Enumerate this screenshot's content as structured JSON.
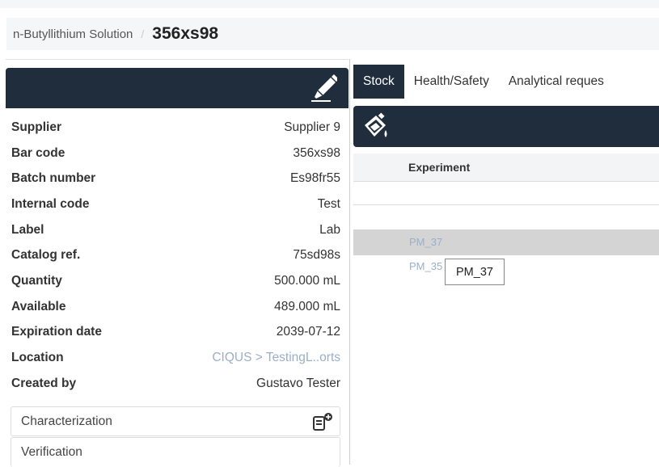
{
  "breadcrumb": {
    "parent": "n-Butyllithium Solution",
    "separator": "/",
    "current": "356xs98"
  },
  "properties": [
    {
      "label": "Supplier",
      "value": "Supplier 9"
    },
    {
      "label": "Bar code",
      "value": "356xs98"
    },
    {
      "label": "Batch number",
      "value": "Es98fr55"
    },
    {
      "label": "Internal code",
      "value": "Test"
    },
    {
      "label": "Label",
      "value": "Lab"
    },
    {
      "label": "Catalog ref.",
      "value": "75sd98s"
    },
    {
      "label": "Quantity",
      "value": "500.000 mL"
    },
    {
      "label": "Available",
      "value": "489.000 mL"
    },
    {
      "label": "Expiration date",
      "value": "2039-07-12"
    },
    {
      "label": "Location",
      "value": "CIQUS > TestingL..orts"
    },
    {
      "label": "Created by",
      "value": "Gustavo Tester"
    }
  ],
  "cards": {
    "characterization": "Characterization",
    "verification": "Verification"
  },
  "tabs": [
    "Stock",
    "Health/Safety",
    "Analytical reques"
  ],
  "table": {
    "header_experiment": "Experiment",
    "rows": [
      "PM_37",
      "PM_35"
    ]
  },
  "tooltip": "PM_37",
  "icons": {
    "edit": "pencil-icon",
    "stock": "flask-pour-icon",
    "characterization": "document-add-icon"
  },
  "colors": {
    "header_dark": "#1f2d3d",
    "link": "#9aafc7",
    "highlight_row": "#d4d4d4"
  }
}
